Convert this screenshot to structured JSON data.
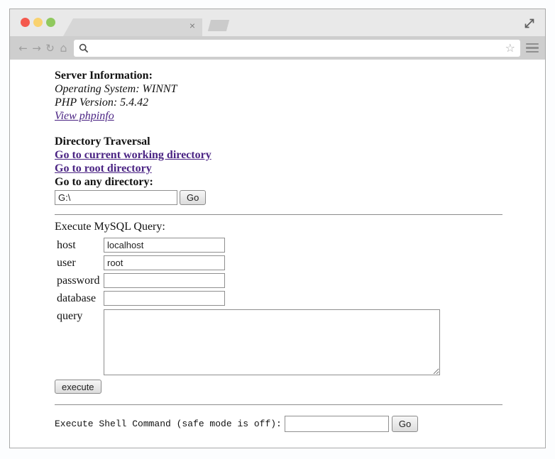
{
  "colors": {
    "link": "#4a2383",
    "traffic_red": "#f4594e",
    "traffic_yellow": "#f9d26f",
    "traffic_green": "#90c95e"
  },
  "browser": {
    "tab_close_icon": "×",
    "back_icon": "←",
    "forward_icon": "→",
    "reload_icon": "↻",
    "home_icon": "⌂",
    "bookmark_icon": "☆",
    "address_value": ""
  },
  "server_info": {
    "heading": "Server Information:",
    "os": "Operating System: WINNT",
    "php": "PHP Version: 5.4.42",
    "phpinfo_link": "View phpinfo"
  },
  "directory": {
    "heading": "Directory Traversal",
    "cwd_link": "Go to current working directory",
    "root_link": "Go to root directory",
    "any_label": "Go to any directory:",
    "path_value": "G:\\",
    "go_button": "Go"
  },
  "mysql": {
    "heading": "Execute MySQL Query:",
    "fields": [
      {
        "label": "host",
        "value": "localhost"
      },
      {
        "label": "user",
        "value": "root"
      },
      {
        "label": "password",
        "value": ""
      },
      {
        "label": "database",
        "value": ""
      }
    ],
    "query_label": "query",
    "query_value": "",
    "execute_button": "execute"
  },
  "shell": {
    "label": "Execute Shell Command (safe mode is off):",
    "command_value": "",
    "go_button": "Go"
  }
}
